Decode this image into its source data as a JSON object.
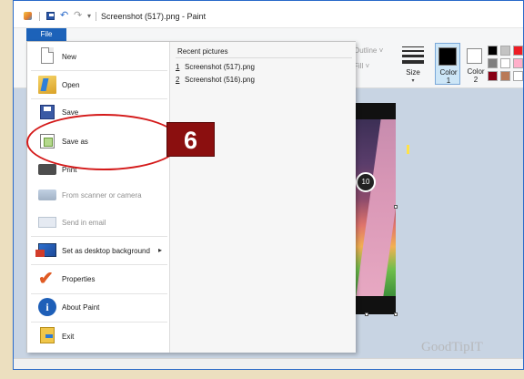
{
  "window": {
    "title": "Screenshot (517).png - Paint",
    "qat_dropdown": "▾",
    "undo_glyph": "↶",
    "redo_glyph": "↷"
  },
  "ribbon": {
    "file_tab": "File",
    "outline_label": "Outline ˅",
    "fill_label": "Fill ˅",
    "size_label": "Size",
    "color1_line1": "Color",
    "color1_line2": "1",
    "color2_line1": "Color",
    "color2_line2": "2",
    "palette_colors": [
      "#000000",
      "#7f7f7f",
      "#880015",
      "#c3c3c3",
      "#ffffff",
      "#b97a57",
      "#ed1c24",
      "#ffaec9",
      "#ffffff",
      "#ffc90e"
    ]
  },
  "file_menu": {
    "items": [
      {
        "label": "New",
        "icon": "new-file-icon",
        "enabled": true
      },
      {
        "label": "Open",
        "icon": "open-folder-icon",
        "enabled": true
      },
      {
        "label": "Save",
        "icon": "save-icon",
        "enabled": true
      },
      {
        "label": "Save as",
        "icon": "save-as-icon",
        "enabled": true
      },
      {
        "label": "Print",
        "icon": "printer-icon",
        "enabled": true
      },
      {
        "label": "From scanner or camera",
        "icon": "scanner-icon",
        "enabled": false
      },
      {
        "label": "Send in email",
        "icon": "email-icon",
        "enabled": false
      },
      {
        "label": "Set as desktop background",
        "icon": "desktop-background-icon",
        "enabled": true,
        "submenu": true
      },
      {
        "label": "Properties",
        "icon": "properties-checkmark-icon",
        "enabled": true
      },
      {
        "label": "About Paint",
        "icon": "info-icon",
        "enabled": true
      },
      {
        "label": "Exit",
        "icon": "exit-icon",
        "enabled": true
      }
    ],
    "submenu_arrow": "▸",
    "properties_glyph": "✔",
    "about_glyph": "i",
    "recent_title": "Recent pictures",
    "recent": [
      {
        "num": "1",
        "name": "Screenshot (517).png"
      },
      {
        "num": "2",
        "name": "Screenshot (516).png"
      }
    ]
  },
  "canvas": {
    "game_badge_text": "10"
  },
  "overlay": {
    "step_number": "6",
    "highlight_color": "#d41a1a",
    "badge_color": "#8b0f0f"
  },
  "watermark": "GoodTipIT"
}
